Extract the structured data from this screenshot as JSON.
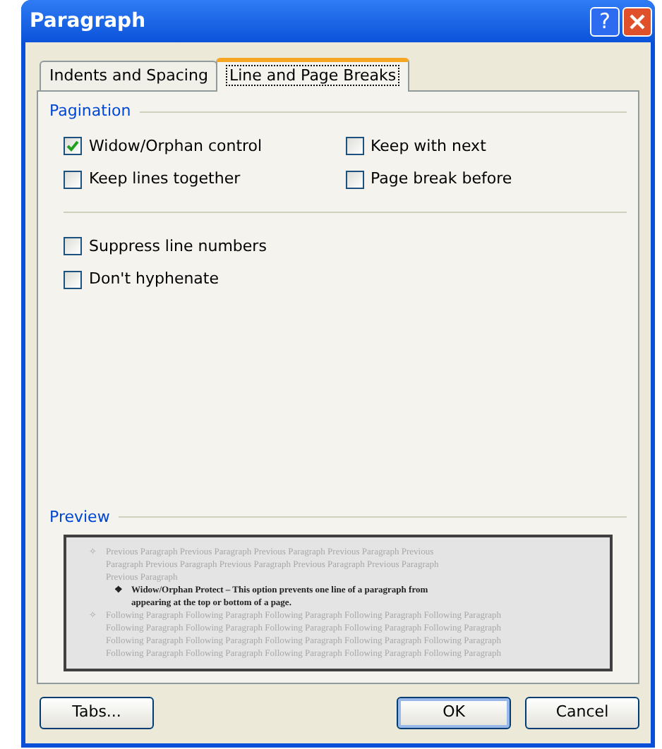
{
  "window": {
    "title": "Paragraph"
  },
  "title_buttons": [
    {
      "kind": "help",
      "label": "?"
    },
    {
      "kind": "close"
    }
  ],
  "tabs": [
    {
      "label": "Indents and Spacing",
      "selected": false
    },
    {
      "label": "Line and Page Breaks",
      "selected": true
    }
  ],
  "pagination": {
    "title": "Pagination",
    "options": [
      {
        "label": "Widow/Orphan control",
        "checked": true
      },
      {
        "label": "Keep with next",
        "checked": false
      },
      {
        "label": "Keep lines together",
        "checked": false
      },
      {
        "label": "Page break before",
        "checked": false
      }
    ]
  },
  "other_options": [
    {
      "label": "Suppress line numbers",
      "checked": false
    },
    {
      "label": "Don't hyphenate",
      "checked": false
    }
  ],
  "preview": {
    "title": "Preview",
    "paragraphs": [
      {
        "kind": "previous",
        "bullet": "✧",
        "lines": [
          "Previous Paragraph Previous Paragraph Previous Paragraph Previous Paragraph Previous",
          "Paragraph Previous Paragraph Previous Paragraph Previous Paragraph Previous Paragraph",
          "Previous Paragraph"
        ]
      },
      {
        "kind": "current",
        "bullet": "❖",
        "lines": [
          "Widow/Orphan Protect – This option prevents one line of a paragraph from",
          "appearing at the top or bottom of a page."
        ]
      },
      {
        "kind": "following",
        "bullet": "✧",
        "lines": [
          "Following Paragraph Following Paragraph Following Paragraph Following Paragraph Following Paragraph",
          "Following Paragraph Following Paragraph Following Paragraph Following Paragraph Following Paragraph",
          "Following Paragraph Following Paragraph Following Paragraph Following Paragraph Following Paragraph",
          "Following Paragraph Following Paragraph Following Paragraph Following Paragraph Following Paragraph"
        ]
      }
    ]
  },
  "buttons": [
    {
      "label": "Tabs...",
      "default": false
    },
    {
      "label": "OK",
      "default": true
    },
    {
      "label": "Cancel",
      "default": false
    }
  ]
}
